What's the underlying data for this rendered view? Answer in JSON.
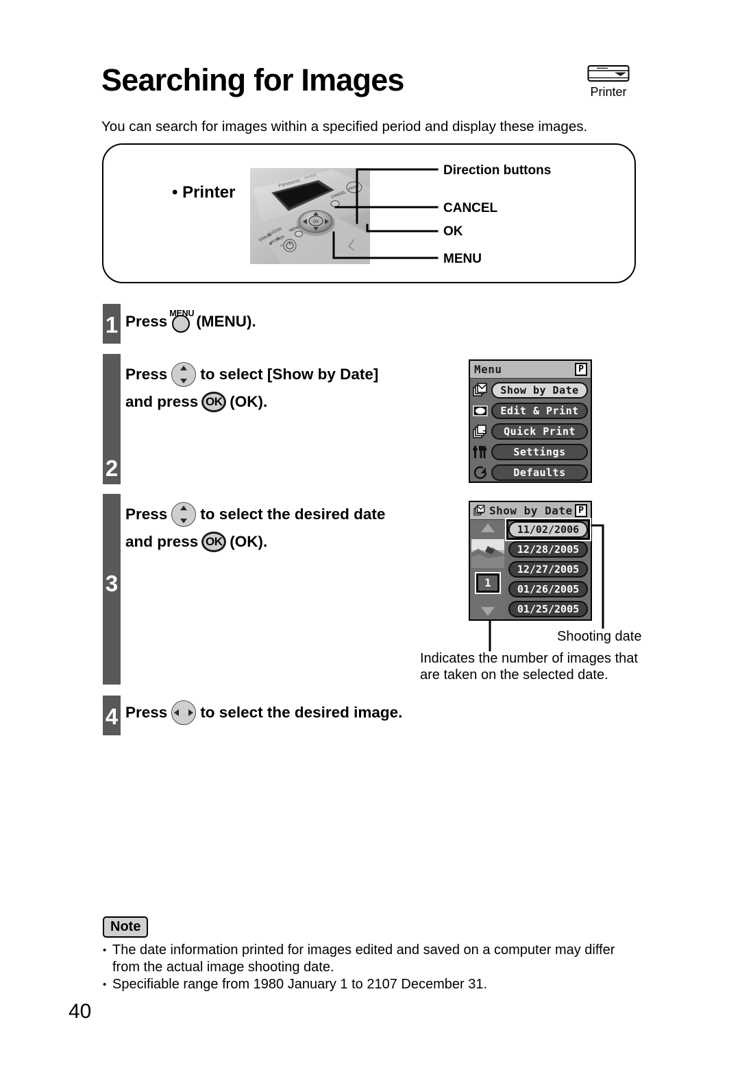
{
  "header": {
    "title": "Searching for Images",
    "badge_label": "Printer",
    "badge_icon": "printer-device-icon"
  },
  "intro": {
    "text": "You can search for images within a specified period and display these images."
  },
  "printer_panel": {
    "label": "• Printer",
    "photo_alt": "printer-control-panel-photo",
    "callouts": {
      "direction": "Direction buttons",
      "cancel": "CANCEL",
      "ok": "OK",
      "menu": "MENU"
    }
  },
  "steps": [
    {
      "number": "1",
      "line1_pre": "Press",
      "icon": "menu-button-icon",
      "icon_label": "MENU",
      "line1_post": "(MENU)."
    },
    {
      "number": "2",
      "line1_pre": "Press",
      "icon": "up-down-button-icon",
      "line1_post": "to select [Show by Date]",
      "line2_pre": "and press",
      "icon2": "ok-button-icon",
      "icon2_label": "OK",
      "line2_post": "(OK)."
    },
    {
      "number": "3",
      "line1_pre": "Press",
      "icon": "up-down-button-icon",
      "line1_post": "to select the desired date",
      "line2_pre": "and press",
      "icon2": "ok-button-icon",
      "icon2_label": "OK",
      "line2_post": "(OK)."
    },
    {
      "number": "4",
      "line1_pre": "Press",
      "icon": "left-right-button-icon",
      "line1_post": "to select the desired image."
    }
  ],
  "lcd_menu": {
    "title": "Menu",
    "corner_badge": "P",
    "rows": [
      {
        "label": "Show by Date",
        "icon": "show-by-date-icon",
        "selected": true
      },
      {
        "label": "Edit & Print",
        "icon": "edit-print-icon",
        "selected": false
      },
      {
        "label": "Quick Print",
        "icon": "quick-print-icon",
        "selected": false
      },
      {
        "label": "Settings",
        "icon": "settings-icon",
        "selected": false
      },
      {
        "label": "Defaults",
        "icon": "defaults-icon",
        "selected": false
      }
    ]
  },
  "lcd_showdate": {
    "title": "Show by Date",
    "title_icon": "show-by-date-icon",
    "corner_badge": "P",
    "image_count": "1",
    "scroll_up": "scroll-up-arrow-icon",
    "scroll_down": "scroll-down-arrow-icon",
    "thumbnail": "photo-thumbnail",
    "dates": [
      {
        "value": "11/02/2006",
        "selected": true
      },
      {
        "value": "12/28/2005",
        "selected": false
      },
      {
        "value": "12/27/2005",
        "selected": false
      },
      {
        "value": "01/26/2005",
        "selected": false
      },
      {
        "value": "01/25/2005",
        "selected": false
      }
    ]
  },
  "annotations": {
    "shooting_date": "Shooting date",
    "count_desc_line1": "Indicates the number of images that",
    "count_desc_line2": "are taken on the selected date."
  },
  "note": {
    "badge": "Note",
    "items": [
      "The date information printed for images edited and saved on a computer may differ from the actual image shooting date.",
      "Specifiable range from 1980 January 1 to 2107 December 31."
    ],
    "item1_line1": "The date information printed for images edited and saved on a computer may differ from the",
    "item1_line2": "actual image shooting date.",
    "item2_line1": "Specifiable range from 1980 January 1 to 2107 December 31."
  },
  "page": {
    "number": "40"
  },
  "colors": {
    "step_bar": "#595959",
    "lcd_background": "#6d6d6d",
    "lcd_titlebar": "#b9b9b9",
    "pill_unselected": "#4c4c4c",
    "pill_selected": "#d6d6d6",
    "note_badge": "#d0d0d0"
  }
}
